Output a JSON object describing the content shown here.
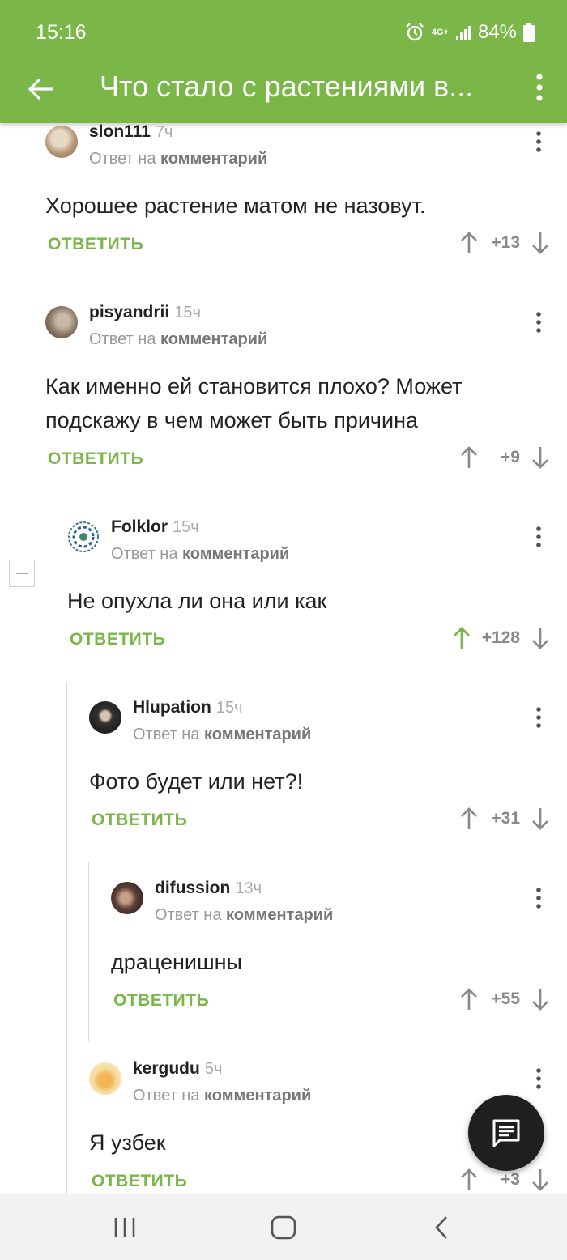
{
  "status_bar": {
    "time": "15:16",
    "network": "4G+",
    "battery": "84%",
    "icons": [
      "alarm-icon",
      "signal-icon",
      "battery-icon"
    ]
  },
  "app_bar": {
    "title": "Что стало с растениями в...",
    "icons": [
      "back-arrow-icon",
      "more-vert-icon"
    ]
  },
  "reply_to_text": "Ответ на",
  "reply_to_link": "комментарий",
  "reply_label": "ОТВЕТИТЬ",
  "comments": [
    {
      "user": "slon111",
      "time": "7ч",
      "text": [
        "Хорошее растение матом не назовут."
      ],
      "score": "+13",
      "upvoted": false
    },
    {
      "user": "pisyandrii",
      "time": "15ч",
      "text": [
        "Как именно ей становится плохо? Может",
        "подскажу в чем может быть причина"
      ],
      "score": "+9",
      "upvoted": false
    },
    {
      "user": "Folklor",
      "time": "15ч",
      "text": [
        "Не опухла ли она или как"
      ],
      "score": "+128",
      "upvoted": true
    },
    {
      "user": "Hlupation",
      "time": "15ч",
      "text": [
        "Фото будет или нет?!"
      ],
      "score": "+31",
      "upvoted": false
    },
    {
      "user": "difussion",
      "time": "13ч",
      "text": [
        "драценишны"
      ],
      "score": "+55",
      "upvoted": false
    },
    {
      "user": "kergudu",
      "time": "5ч",
      "text": [
        "Я узбек"
      ],
      "score": "+3",
      "upvoted": false
    }
  ],
  "colors": {
    "accent": "#7ab648",
    "upvote_active": "#7ab648",
    "text": "#222222",
    "muted": "#999999"
  },
  "fab": {
    "icon": "comment-icon"
  },
  "nav_bar": {
    "icons": [
      "recents-icon",
      "home-icon",
      "back-icon"
    ]
  }
}
